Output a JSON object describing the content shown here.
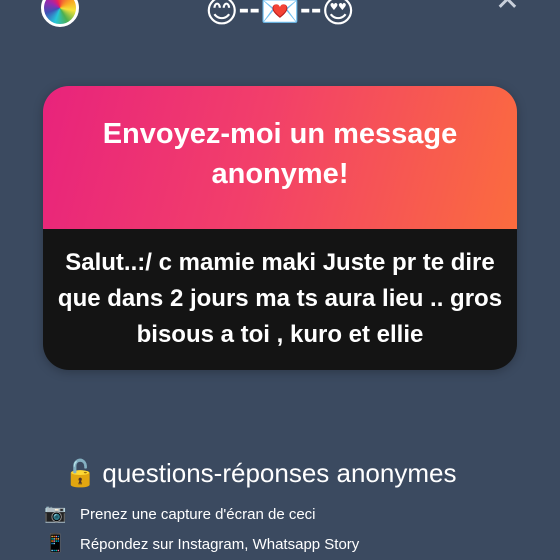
{
  "header": {
    "emoji_left": "😊",
    "separator": "--",
    "emoji_middle": "💌",
    "emoji_right": "😍",
    "close_label": "✕"
  },
  "card": {
    "title": "Envoyez-moi un message anonyme!",
    "message": "Salut..:/ c mamie maki Juste pr te dire que dans 2 jours ma ts aura lieu .. gros bisous a toi , kuro et ellie"
  },
  "footer": {
    "lock_icon": "🔓",
    "title": "questions-réponses anonymes",
    "steps": [
      {
        "icon": "📷",
        "icon_name": "camera-icon",
        "text": "Prenez une capture d'écran de ceci"
      },
      {
        "icon": "📱",
        "icon_name": "phone-icon",
        "text": "Répondez sur Instagram, Whatsapp Story"
      }
    ]
  },
  "colors": {
    "background": "#3b4a60",
    "card_gradient_start": "#e8237c",
    "card_gradient_end": "#fb6c3e",
    "card_body": "#141414"
  }
}
